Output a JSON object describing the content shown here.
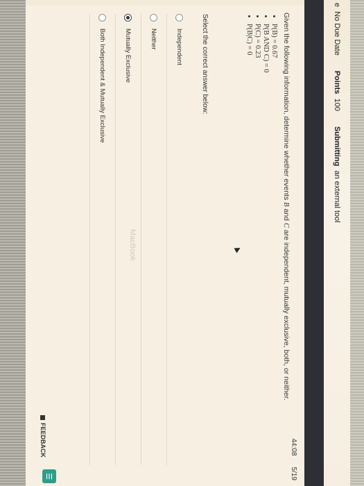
{
  "topbar": {
    "due_prefix": "e",
    "due_value": "No Due Date",
    "points_label": "Points",
    "points_value": "100",
    "submitting_label": "Submitting",
    "submitting_value": "an external tool"
  },
  "quiz": {
    "timer": "44:08",
    "progress": "5/19",
    "question_prefix": "Given the following information, determine whether events ",
    "event_b": "B",
    "question_mid": " and ",
    "event_c": "C",
    "question_suffix": " are independent, mutually exclusive, both, or neither.",
    "facts": [
      "P(B) = 0.67",
      "P(B AND C) = 0",
      "P(C) = 0.23",
      "P(B|C) = 0"
    ],
    "prompt": "Select the correct answer below:",
    "options": [
      {
        "label": "Independent",
        "selected": false
      },
      {
        "label": "Neither",
        "selected": false
      },
      {
        "label": "Mutually Exclusive",
        "selected": true
      },
      {
        "label": "Both Independent & Mutually Exclusive",
        "selected": false
      }
    ],
    "feedback_label": "FEEDBACK"
  },
  "watermark": "MacBook",
  "colors": {
    "accent": "#2c9e8c",
    "band": "#2e2f35"
  }
}
